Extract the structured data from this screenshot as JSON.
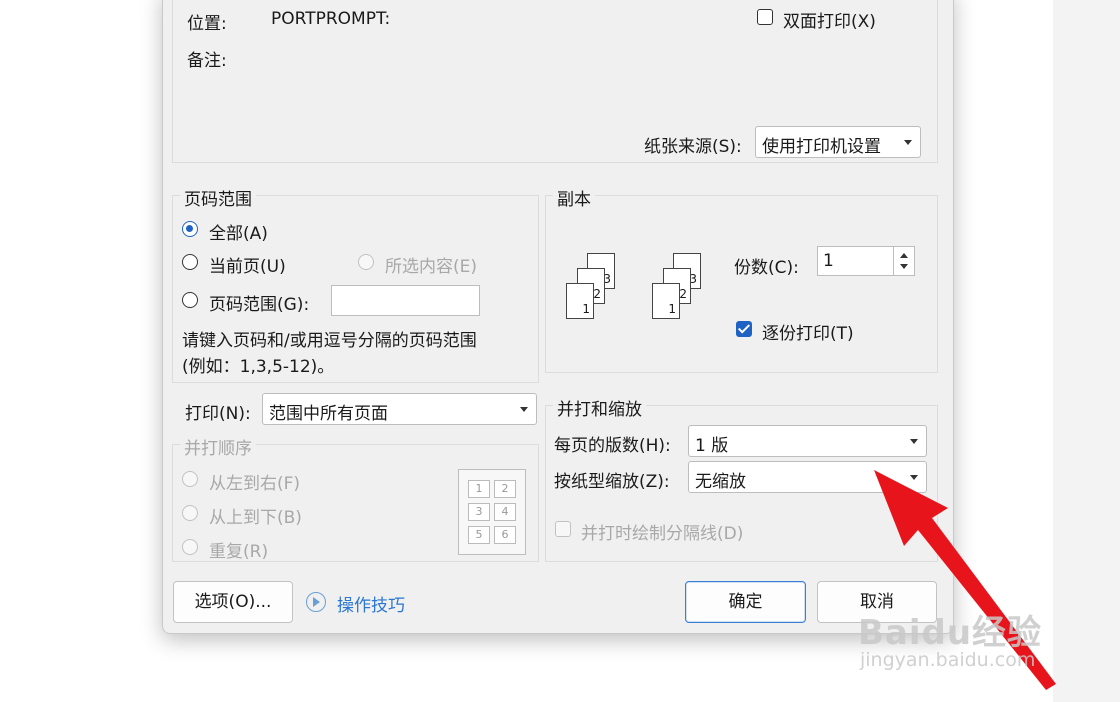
{
  "printer": {
    "location_label": "位置:",
    "location_value": "PORTPROMPT:",
    "comment_label": "备注:",
    "duplex_label": "双面打印(X)",
    "duplex_checked": false,
    "paper_source_label": "纸张来源(S):",
    "paper_source_value": "使用打印机设置"
  },
  "page_range": {
    "legend": "页码范围",
    "all_label": "全部(A)",
    "current_label": "当前页(U)",
    "selection_label": "所选内容(E)",
    "pages_label": "页码范围(G):",
    "pages_value": "",
    "hint_line1": "请键入页码和/或用逗号分隔的页码范围",
    "hint_line2": "(例如：1,3,5-12)。",
    "selected": "all"
  },
  "print_what": {
    "label": "打印(N):",
    "value": "范围中所有页面"
  },
  "print_order": {
    "legend": "并打顺序",
    "left_to_right": "从左到右(F)",
    "top_to_bottom": "从上到下(B)",
    "repeat": "重复(R)",
    "layout_cells": [
      "1",
      "2",
      "3",
      "4",
      "5",
      "6"
    ]
  },
  "copies": {
    "legend": "副本",
    "count_label": "份数(C):",
    "count_value": "1",
    "collate_label": "逐份打印(T)",
    "collate_checked": true,
    "page_numbers": [
      "1",
      "2",
      "3"
    ]
  },
  "zoom": {
    "legend": "并打和缩放",
    "pages_per_sheet_label": "每页的版数(H):",
    "pages_per_sheet_value": "1 版",
    "scale_label": "按纸型缩放(Z):",
    "scale_value": "无缩放",
    "draw_borders_label": "并打时绘制分隔线(D)"
  },
  "footer": {
    "options_label": "选项(O)...",
    "tips_label": "操作技巧",
    "ok_label": "确定",
    "cancel_label": "取消"
  },
  "watermark": {
    "brand": "Baidu经验",
    "url": "jingyan.baidu.com"
  },
  "colors": {
    "accent": "#1e63c4",
    "link": "#2a76d2",
    "arrow": "#e8141b"
  }
}
